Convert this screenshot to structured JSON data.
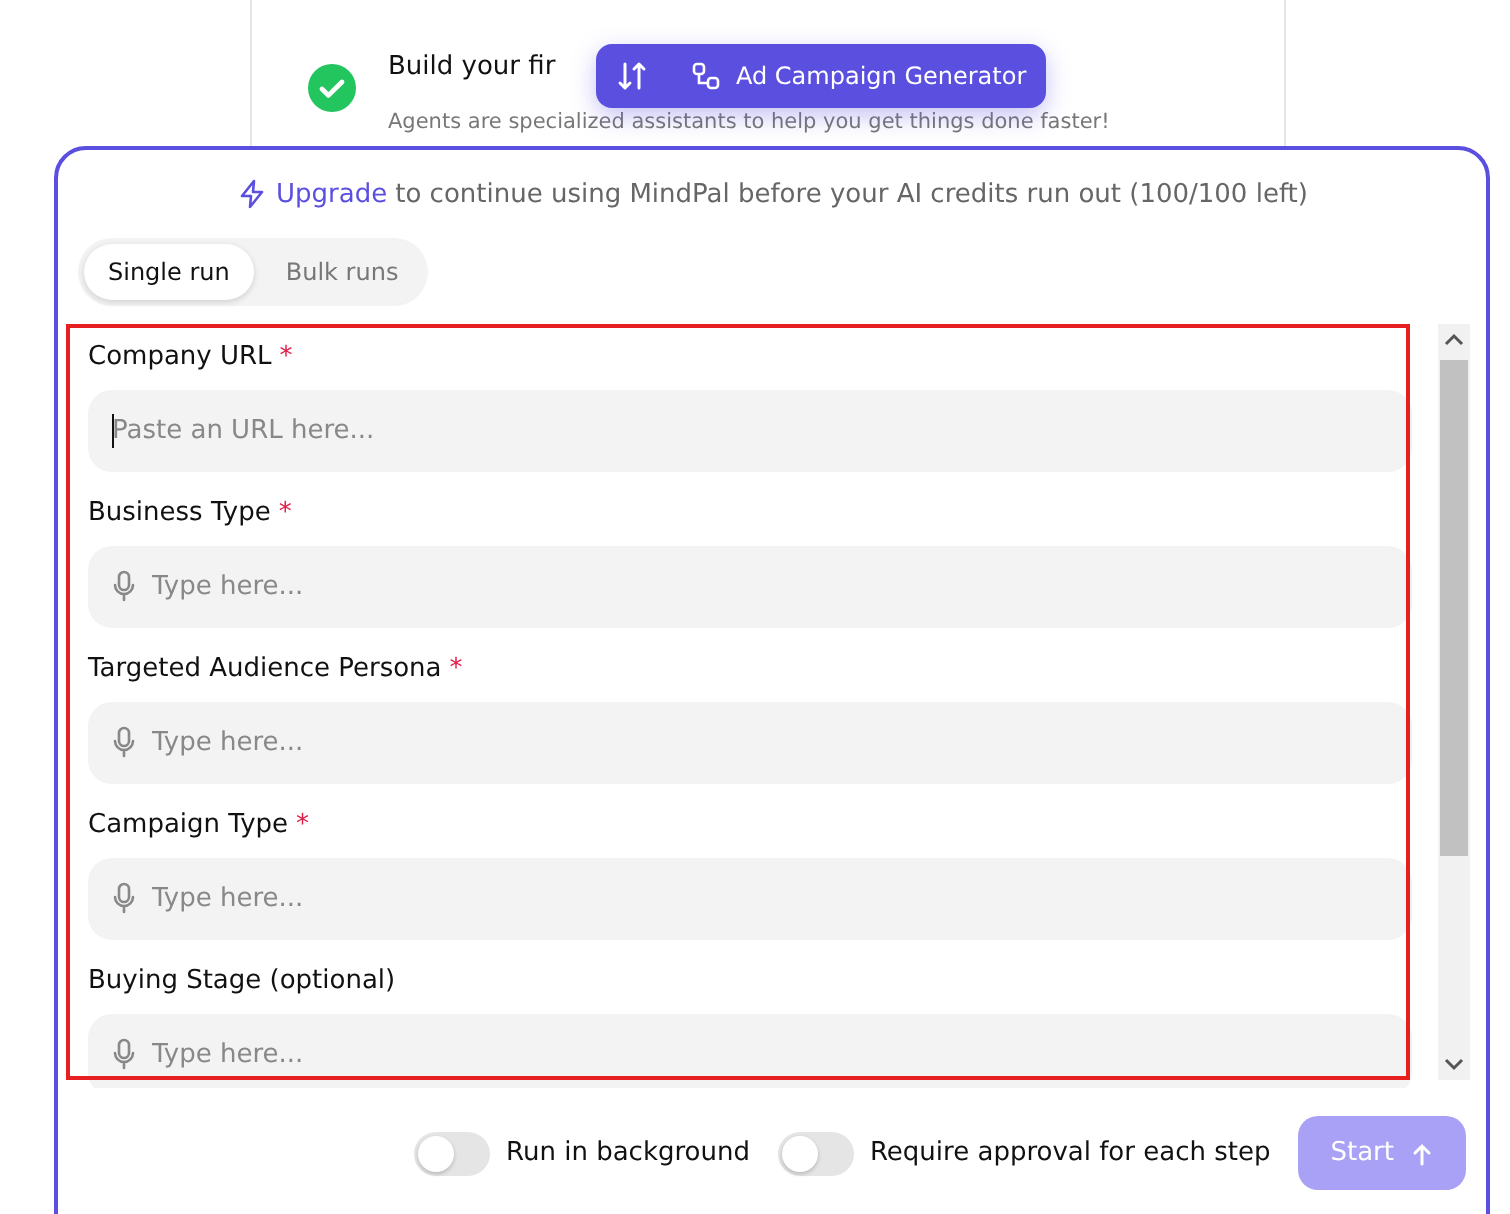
{
  "background_card": {
    "title": "Build your fir",
    "subtitle": "Agents are specialized assistants to help you get things done faster!",
    "completed": true
  },
  "floating_bar": {
    "agent_name": "Ad Campaign Generator"
  },
  "upgrade_notice": {
    "link": "Upgrade",
    "text": "to continue using MindPal before your AI credits run out (100/100 left)"
  },
  "tabs": [
    {
      "label": "Single run",
      "selected": true
    },
    {
      "label": "Bulk runs",
      "selected": false
    }
  ],
  "fields": [
    {
      "label": "Company URL",
      "required_mark": "*",
      "placeholder": "Paste an URL here...",
      "voice": false,
      "focused": true
    },
    {
      "label": "Business Type",
      "required_mark": "*",
      "placeholder": "Type here...",
      "voice": true,
      "focused": false
    },
    {
      "label": "Targeted Audience Persona",
      "required_mark": "*",
      "placeholder": "Type here...",
      "voice": true,
      "focused": false
    },
    {
      "label": "Campaign Type",
      "required_mark": "*",
      "placeholder": "Type here...",
      "voice": true,
      "focused": false
    },
    {
      "label": "Buying Stage (optional)",
      "placeholder": "Type here...",
      "voice": true,
      "focused": false
    }
  ],
  "options": [
    {
      "label": "Run in background",
      "on": false
    },
    {
      "label": "Require approval for each step",
      "on": false
    }
  ],
  "start_button": {
    "label": "Start",
    "disabled": true
  }
}
